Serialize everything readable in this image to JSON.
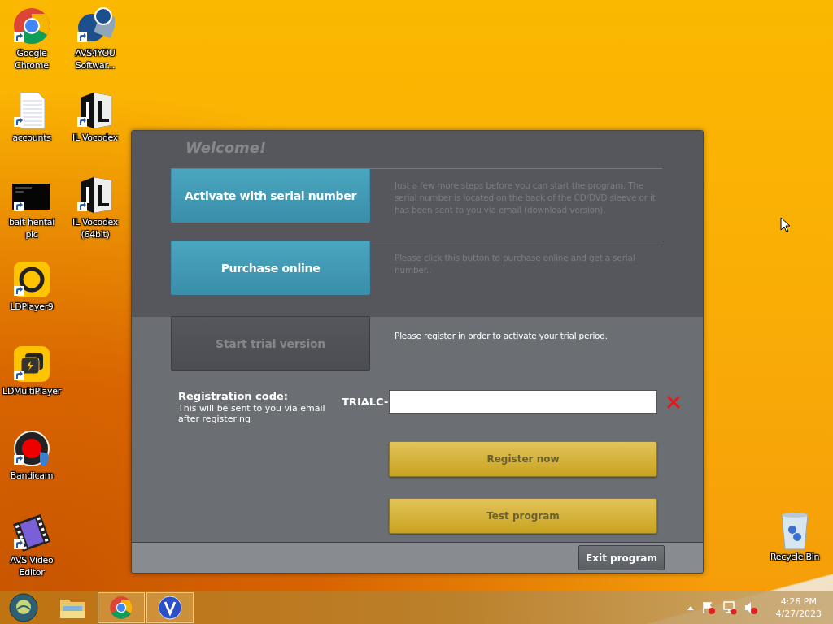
{
  "desktop": {
    "column_1": [
      {
        "label": "Google Chrome",
        "kind": "chrome"
      },
      {
        "label": "accounts",
        "kind": "document"
      },
      {
        "label": "bait hentai pic",
        "kind": "picture"
      },
      {
        "label": "LDPlayer9",
        "kind": "ldplayer"
      },
      {
        "label": "LDMultiPlayer",
        "kind": "ldmulti"
      },
      {
        "label": "Bandicam",
        "kind": "bandicam"
      },
      {
        "label": "AVS Video Editor",
        "kind": "film"
      }
    ],
    "column_2": [
      {
        "label": "AVS4YOU Softwar...",
        "kind": "avs"
      },
      {
        "label": "IL Vocodex",
        "kind": "vocodex"
      },
      {
        "label": "IL Vocodex (64bit)",
        "kind": "vocodex"
      }
    ],
    "recycle_bin": {
      "label": "Recycle Bin"
    }
  },
  "dialog": {
    "title": "Welcome!",
    "options": [
      {
        "label": "Activate with serial number",
        "description": "Just a few more steps before you can start the program. The serial number is located on the back of the CD/DVD sleeve or it has been sent to you via email (download version).",
        "selected": false
      },
      {
        "label": "Purchase online",
        "description": "Please click this button to purchase online and get a serial number..",
        "selected": false
      },
      {
        "label": "Start trial version",
        "description": "Please register in order to activate your trial period.",
        "selected": true
      }
    ],
    "registration": {
      "label": "Registration code:",
      "hint": "This will be sent to you via email after registering",
      "prefix": "TRIALC-"
    },
    "buttons": [
      "Register now",
      "Test program"
    ],
    "exit_button": "Exit program"
  },
  "taskbar": {
    "items": [
      {
        "kind": "start",
        "running": false
      },
      {
        "kind": "explorer",
        "running": false
      },
      {
        "kind": "chrome",
        "running": true
      },
      {
        "kind": "v",
        "running": true
      }
    ],
    "time": "4:26 PM",
    "date": "4/27/2023"
  }
}
